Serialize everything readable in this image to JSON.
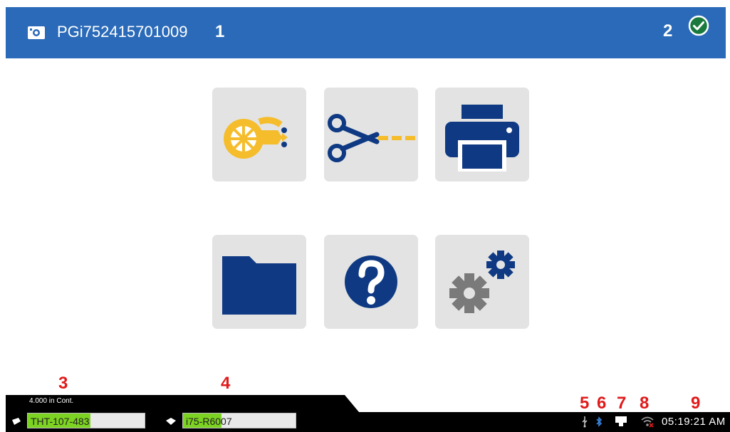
{
  "header": {
    "device_id": "PGi752415701009",
    "callout_1": "1",
    "callout_2": "2",
    "status_icon": "check-circle-icon",
    "accent_color": "#2a6ab8"
  },
  "tiles": [
    {
      "name": "supply-feed-icon",
      "color": "#f5bd2b"
    },
    {
      "name": "cut-icon",
      "color": "#f5bd2b"
    },
    {
      "name": "print-icon",
      "color": "#0f3a83"
    },
    {
      "name": "folder-icon",
      "color": "#0f3a83"
    },
    {
      "name": "help-icon",
      "color": "#0f3a83"
    },
    {
      "name": "settings-icon",
      "color": "#7a7a7a"
    }
  ],
  "callouts": {
    "c3": "3",
    "c4": "4",
    "c5": "5",
    "c6": "6",
    "c7": "7",
    "c8": "8",
    "c9": "9"
  },
  "status_bar": {
    "supply_length": "4.000 in Cont.",
    "label_part": "THT-107-483",
    "ribbon_part": "i75-R6007",
    "time": "05:19:21 AM",
    "highlight_color": "#7cd321"
  }
}
